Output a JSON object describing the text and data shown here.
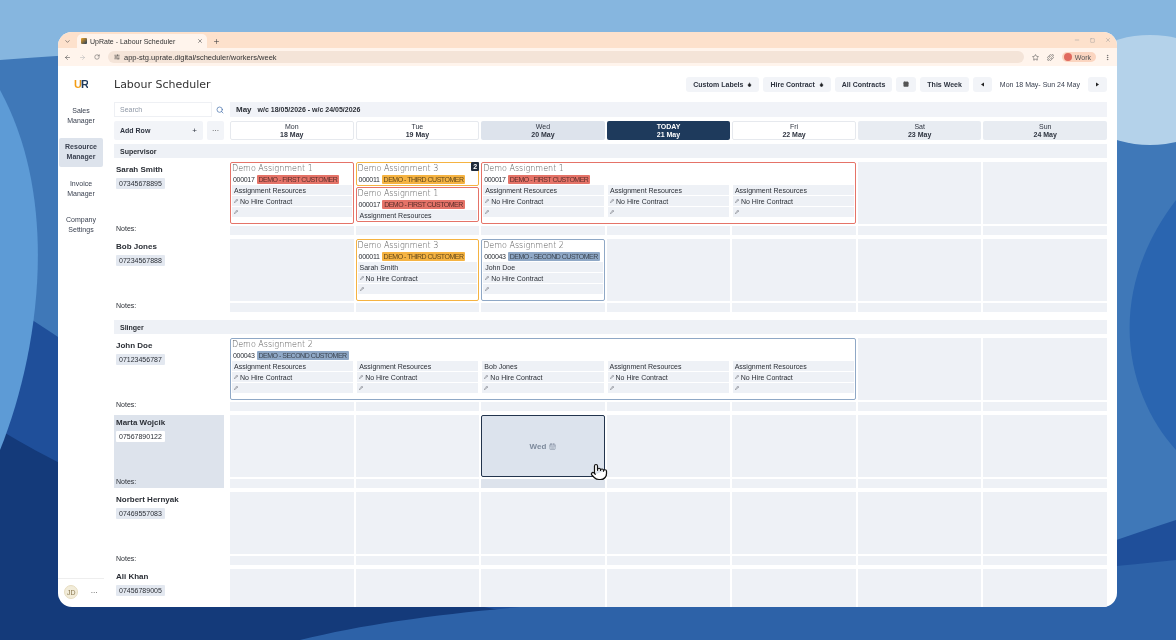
{
  "browser": {
    "tab_title": "UpRate - Labour Scheduler",
    "url": "app-stg.uprate.digital/scheduler/workers/week",
    "profile": "Work"
  },
  "app": {
    "logo": "UR",
    "title": "Labour Scheduler"
  },
  "nav": [
    {
      "label": "Sales Manager",
      "selected": false
    },
    {
      "label": "Resource Manager",
      "selected": true
    },
    {
      "label": "Invoice Manager",
      "selected": false
    },
    {
      "label": "Company Settings",
      "selected": false
    }
  ],
  "user": {
    "initials": "JD",
    "more": "···"
  },
  "toolbar": {
    "filters": [
      {
        "label": "Custom Labels",
        "kind": "dropdown"
      },
      {
        "label": "Hire Contract",
        "kind": "dropdown"
      },
      {
        "label": "All Contracts",
        "kind": "plain"
      }
    ],
    "period": "This Week",
    "range": "Mon 18 May- Sun 24 May"
  },
  "search": {
    "placeholder": "Search"
  },
  "week": {
    "month": "May",
    "range": "w/c 18/05/2026 - w/c 24/05/2026"
  },
  "add_row": {
    "label": "Add Row",
    "icon": "+",
    "more": "···"
  },
  "days": [
    {
      "label": "Mon",
      "date": "18 May",
      "kind": "normal"
    },
    {
      "label": "Tue",
      "date": "19 May",
      "kind": "normal"
    },
    {
      "label": "Wed",
      "date": "20 May",
      "kind": "hover"
    },
    {
      "label": "TODAY",
      "date": "21 May",
      "kind": "today"
    },
    {
      "label": "Fri",
      "date": "22 May",
      "kind": "normal"
    },
    {
      "label": "Sat",
      "date": "23 May",
      "kind": "weekend"
    },
    {
      "label": "Sun",
      "date": "24 May",
      "kind": "weekend"
    }
  ],
  "groups": [
    {
      "label": "Supervisor",
      "workers": [
        {
          "name": "Sarah Smith",
          "phone": "07345678895",
          "selected": false,
          "notes": "Notes:",
          "slots": [
            {
              "kind": "assignment",
              "title": "Demo Assignment 1",
              "code": "000017",
              "customer": "DEMO - FIRST CUSTOMER",
              "color": "#e57368",
              "days": [
                {
                  "resource": "Assignment Resources",
                  "contract": "No Hire Contract"
                }
              ]
            },
            {
              "kind": "stack",
              "count": "2",
              "cards": [
                {
                  "title": "Demo Assignment 3",
                  "code": "000011",
                  "customer": "DEMO - THIRD CUSTOMER",
                  "color": "#f5b342"
                },
                {
                  "title": "Demo Assignment 1",
                  "code": "000017",
                  "customer": "DEMO - FIRST CUSTOMER",
                  "color": "#e57368",
                  "days": [
                    {
                      "resource": "Assignment Resources"
                    }
                  ]
                }
              ]
            },
            {
              "kind": "assignment",
              "title": "Demo Assignment 1",
              "code": "000017",
              "customer": "DEMO - FIRST CUSTOMER",
              "color": "#e57368",
              "days": [
                {
                  "resource": "Assignment Resources",
                  "contract": "No Hire Contract"
                },
                {
                  "resource": "Assignment Resources",
                  "contract": "No Hire Contract"
                },
                {
                  "resource": "Assignment Resources",
                  "contract": "No Hire Contract"
                }
              ]
            },
            {
              "kind": "covered"
            },
            {
              "kind": "covered"
            },
            {
              "kind": "empty"
            },
            {
              "kind": "empty"
            }
          ]
        },
        {
          "name": "Bob Jones",
          "phone": "07234567888",
          "selected": false,
          "notes": "Notes:",
          "slots": [
            {
              "kind": "empty"
            },
            {
              "kind": "assignment",
              "title": "Demo Assignment 3",
              "code": "000011",
              "customer": "DEMO - THIRD CUSTOMER",
              "color": "#f5b342",
              "days": [
                {
                  "resource": "Sarah Smith",
                  "contract": "No Hire Contract"
                }
              ]
            },
            {
              "kind": "assignment",
              "title": "Demo Assignment 2",
              "code": "000043",
              "customer": "DEMO - SECOND CUSTOMER",
              "color": "#8fa8c6",
              "days": [
                {
                  "resource": "John Doe",
                  "contract": "No Hire Contract"
                }
              ]
            },
            {
              "kind": "empty"
            },
            {
              "kind": "empty"
            },
            {
              "kind": "empty"
            },
            {
              "kind": "empty"
            }
          ]
        }
      ]
    },
    {
      "label": "Slinger",
      "workers": [
        {
          "name": "John Doe",
          "phone": "07123456787",
          "selected": false,
          "notes": "Notes:",
          "slots": [
            {
              "kind": "assignment",
              "title": "Demo Assignment 2",
              "code": "000043",
              "customer": "DEMO - SECOND CUSTOMER",
              "color": "#8fa8c6",
              "days": [
                {
                  "resource": "Assignment Resources",
                  "contract": "No Hire Contract"
                },
                {
                  "resource": "Assignment Resources",
                  "contract": "No Hire Contract"
                },
                {
                  "resource": "Bob Jones",
                  "contract": "No Hire Contract"
                },
                {
                  "resource": "Assignment Resources",
                  "contract": "No Hire Contract"
                },
                {
                  "resource": "Assignment Resources",
                  "contract": "No Hire Contract"
                }
              ]
            },
            {
              "kind": "covered"
            },
            {
              "kind": "covered"
            },
            {
              "kind": "covered"
            },
            {
              "kind": "covered"
            },
            {
              "kind": "empty"
            },
            {
              "kind": "empty"
            }
          ]
        },
        {
          "name": "Marta Wojcik",
          "phone": "07567890122",
          "selected": true,
          "notes": "Notes:",
          "slots": [
            {
              "kind": "empty"
            },
            {
              "kind": "empty"
            },
            {
              "kind": "drop",
              "label": "Wed"
            },
            {
              "kind": "empty"
            },
            {
              "kind": "empty"
            },
            {
              "kind": "empty"
            },
            {
              "kind": "empty"
            }
          ]
        },
        {
          "name": "Norbert Hernyak",
          "phone": "07469557083",
          "selected": false,
          "notes": "Notes:",
          "slots": [
            {
              "kind": "empty"
            },
            {
              "kind": "empty"
            },
            {
              "kind": "empty"
            },
            {
              "kind": "empty"
            },
            {
              "kind": "empty"
            },
            {
              "kind": "empty"
            },
            {
              "kind": "empty"
            }
          ]
        },
        {
          "name": "Ali Khan",
          "phone": "07456789005",
          "selected": false,
          "slots": [
            {
              "kind": "empty"
            },
            {
              "kind": "empty"
            },
            {
              "kind": "empty"
            },
            {
              "kind": "empty"
            },
            {
              "kind": "empty"
            },
            {
              "kind": "empty"
            },
            {
              "kind": "empty"
            }
          ]
        }
      ]
    }
  ]
}
